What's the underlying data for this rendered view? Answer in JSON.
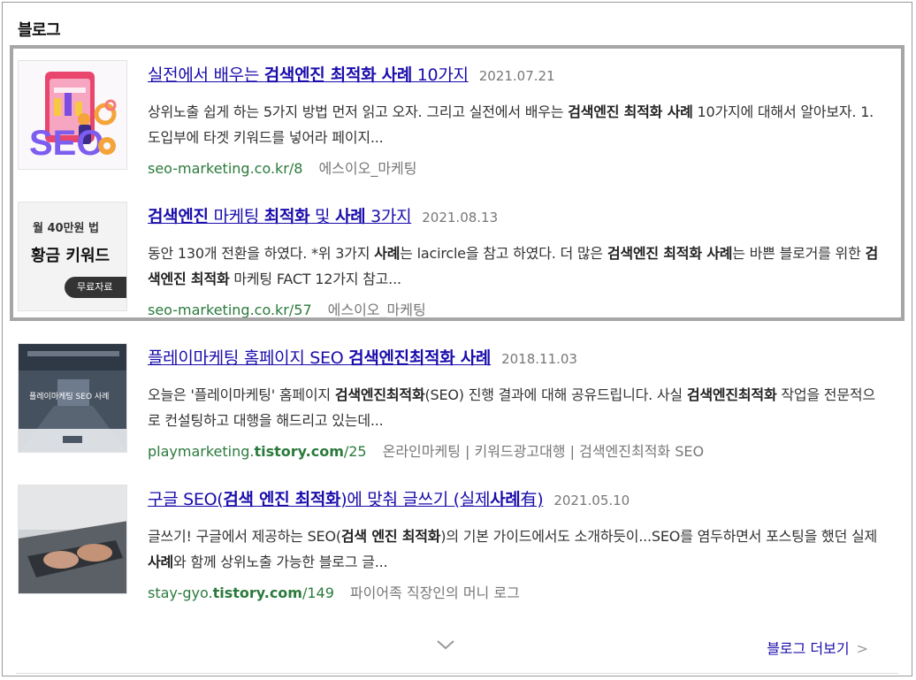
{
  "section": {
    "title": "블로그"
  },
  "items": [
    {
      "title_pre": "실전에서 배우는 ",
      "title_bold": "검색엔진 최적화 사례",
      "title_post": " 10가지",
      "date": "2021.07.21",
      "desc_1": "상위노출 쉽게 하는 5가지 방법 먼저 읽고 오자. 그리고 실전에서 배우는 ",
      "desc_bold_1": "검색엔진 최적화 사례",
      "desc_2": " 10가지에 대해서 알아보자. 1. 도입부에 타겟 키워드를 넣어라 페이지...",
      "url_pre": "seo-marketing.co.kr/8",
      "source": "에스이오_마케팅",
      "thumb_text": "SEO"
    },
    {
      "title_pre": "",
      "title_bold": "검색엔진",
      "title_post": " 마케팅 ",
      "title_bold2": "최적화",
      "title_post2": " 및 ",
      "title_bold3": "사례",
      "title_post3": " 3가지",
      "date": "2021.08.13",
      "desc_1": "동안 130개 전환을 하였다. *위 3가지 ",
      "desc_bold_1": "사례",
      "desc_2": "는 lacircle을 참고 하였다. 더 많은 ",
      "desc_bold_2": "검색엔진 최적화 사례",
      "desc_3": "는 바쁜 블로거를 위한 ",
      "desc_bold_3": "검색엔진 최적화",
      "desc_4": " 마케팅 FACT 12가지 참고...",
      "url_pre": "seo-marketing.co.kr/57",
      "source": "에스이오_마케팅",
      "thumb_line1": "월 40만원 법",
      "thumb_line2": "황금 키워드",
      "thumb_btn": "무료자료"
    },
    {
      "title_pre": "플레이마케팅 홈페이지 SEO ",
      "title_bold": "검색엔진최적화 사례",
      "date": "2018.11.03",
      "desc_1": "오늘은 '플레이마케팅' 홈페이지 ",
      "desc_bold_1": "검색엔진최적화",
      "desc_2": "(SEO) 진행 결과에 대해 공유드립니다. 사실 ",
      "desc_bold_2": "검색엔진최적화",
      "desc_3": " 작업을 전문적으로 컨설팅하고 대행을 해드리고 있는데...",
      "url_pre": "playmarketing.",
      "url_bold": "tistory.com",
      "url_post": "/25",
      "source": "온라인마케팅 | 키워드광고대행 | 검색엔진최적화 SEO",
      "thumb_caption": "플레이마케팅 SEO 사례"
    },
    {
      "title_pre": "구글 SEO(",
      "title_bold": "검색 엔진 최적화",
      "title_post": ")에 맞춰 글쓰기 (실제",
      "title_bold2": "사례",
      "title_post2": "有)",
      "date": "2021.05.10",
      "desc_1": "글쓰기! 구글에서 제공하는 SEO(",
      "desc_bold_1": "검색 엔진 최적화",
      "desc_2": ")의 기본 가이드에서도 소개하듯이...SEO를 염두하면서 포스팅을 했던 실제 ",
      "desc_bold_2": "사례",
      "desc_3": "와 함께 상위노출 가능한 블로그 글...",
      "url_pre": "stay-gyo.",
      "url_bold": "tistory.com",
      "url_post": "/149",
      "source": "파이어족 직장인의 머니 로그"
    }
  ],
  "footer": {
    "more_label": "블로그 더보기",
    "more_arrow": ">"
  }
}
